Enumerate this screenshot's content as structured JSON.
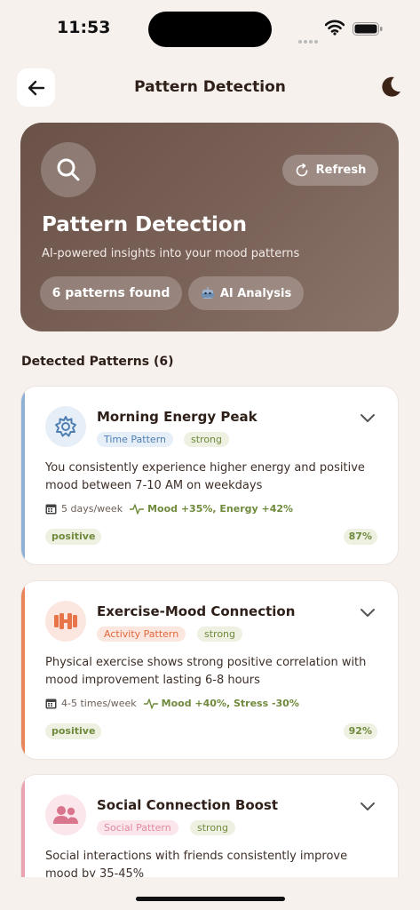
{
  "status_bar": {
    "time": "11:53"
  },
  "header": {
    "title": "Pattern Detection"
  },
  "hero": {
    "refresh_label": "Refresh",
    "title": "Pattern Detection",
    "subtitle": "AI-powered insights into your mood patterns",
    "patterns_found": "6 patterns found",
    "ai_label": "AI Analysis"
  },
  "section": {
    "heading": "Detected Patterns (6)"
  },
  "patterns": [
    {
      "title": "Morning Energy Peak",
      "type_tag": "Time Pattern",
      "strength": "strong",
      "description": "You consistently experience higher energy and positive mood between 7-10 AM on weekdays",
      "frequency": "5 days/week",
      "metrics": "Mood +35%, Energy +42%",
      "sentiment": "positive",
      "confidence": "87%",
      "icon": "gear-icon",
      "accent": "#8fb1d6"
    },
    {
      "title": "Exercise-Mood Connection",
      "type_tag": "Activity Pattern",
      "strength": "strong",
      "description": "Physical exercise shows strong positive correlation with mood improvement lasting 6-8 hours",
      "frequency": "4-5 times/week",
      "metrics": "Mood +40%, Stress -30%",
      "sentiment": "positive",
      "confidence": "92%",
      "icon": "dumbbell-icon",
      "accent": "#e8855a"
    },
    {
      "title": "Social Connection Boost",
      "type_tag": "Social Pattern",
      "strength": "strong",
      "description": "Social interactions with friends consistently improve mood by 35-45%",
      "icon": "people-icon",
      "accent": "#e9a3b3"
    }
  ]
}
